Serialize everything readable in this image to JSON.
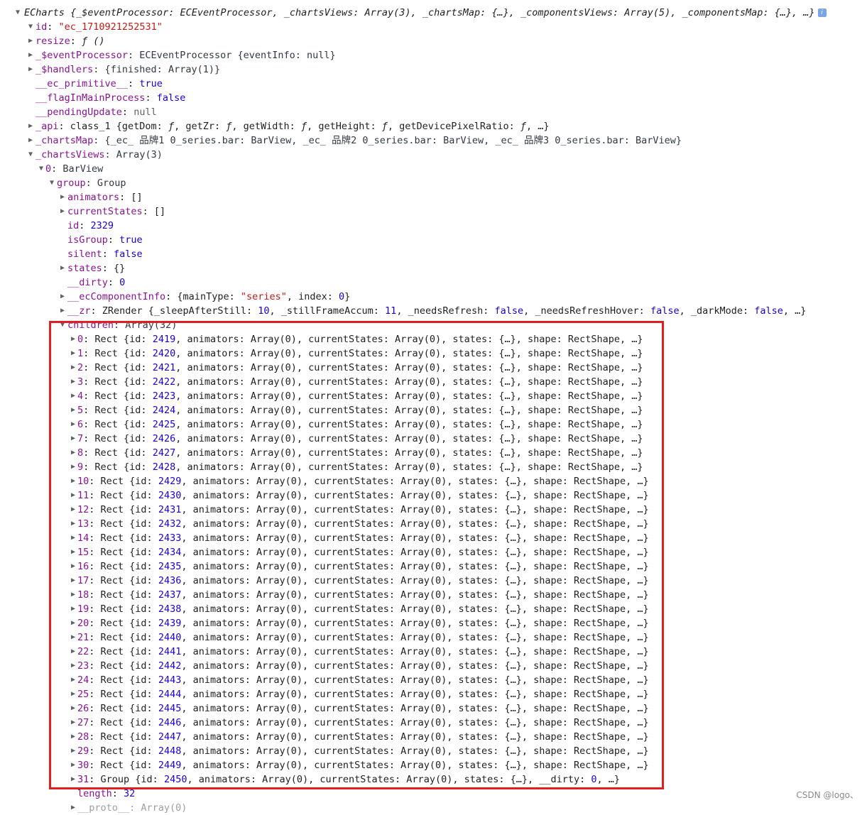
{
  "header": {
    "text": "ECharts {_$eventProcessor: ECEventProcessor, _chartsViews: Array(3), _chartsMap: {…}, _componentsViews: Array(5), _componentsMap: {…}, …}",
    "info_icon": "info-icon"
  },
  "rows": [
    {
      "indent": 0,
      "tw": "open",
      "parts": [
        {
          "t": "id",
          "c": "k-purple"
        },
        {
          "t": ": "
        },
        {
          "t": "\"ec_1710921252531\"",
          "c": "v-str"
        }
      ]
    },
    {
      "indent": 0,
      "tw": "closed",
      "parts": [
        {
          "t": "resize",
          "c": "k-purple"
        },
        {
          "t": ": "
        },
        {
          "t": "ƒ ()",
          "c": "ital"
        }
      ]
    },
    {
      "indent": 0,
      "tw": "closed",
      "parts": [
        {
          "t": "_$eventProcessor",
          "c": "k-purple"
        },
        {
          "t": ": ECEventProcessor {eventInfo: null}",
          "c": "obj"
        }
      ]
    },
    {
      "indent": 0,
      "tw": "closed",
      "parts": [
        {
          "t": "_$handlers",
          "c": "k-purple"
        },
        {
          "t": ": {finished: Array(1)}",
          "c": "obj"
        }
      ]
    },
    {
      "indent": 0,
      "tw": "none",
      "parts": [
        {
          "t": "__ec_primitive__",
          "c": "k-purple"
        },
        {
          "t": ": "
        },
        {
          "t": "true",
          "c": "v-bool"
        }
      ]
    },
    {
      "indent": 0,
      "tw": "none",
      "parts": [
        {
          "t": "__flagInMainProcess",
          "c": "k-purple"
        },
        {
          "t": ": "
        },
        {
          "t": "false",
          "c": "v-bool"
        }
      ]
    },
    {
      "indent": 0,
      "tw": "none",
      "parts": [
        {
          "t": "__pendingUpdate",
          "c": "k-purple"
        },
        {
          "t": ": "
        },
        {
          "t": "null",
          "c": "v-null"
        }
      ]
    },
    {
      "indent": 0,
      "tw": "closed",
      "parts": [
        {
          "t": "_api",
          "c": "k-purple"
        },
        {
          "t": ": class_1 {getDom: "
        },
        {
          "t": "ƒ",
          "c": "ital"
        },
        {
          "t": ", getZr: "
        },
        {
          "t": "ƒ",
          "c": "ital"
        },
        {
          "t": ", getWidth: "
        },
        {
          "t": "ƒ",
          "c": "ital"
        },
        {
          "t": ", getHeight: "
        },
        {
          "t": "ƒ",
          "c": "ital"
        },
        {
          "t": ", getDevicePixelRatio: "
        },
        {
          "t": "ƒ",
          "c": "ital"
        },
        {
          "t": ", …}"
        }
      ]
    },
    {
      "indent": 0,
      "tw": "closed",
      "parts": [
        {
          "t": "_chartsMap",
          "c": "k-purple"
        },
        {
          "t": ": {_ec_ 品牌1 0_series.bar: BarView, _ec_ 品牌2 0_series.bar: BarView, _ec_ 品牌3 0_series.bar: BarView}",
          "c": "obj"
        }
      ]
    },
    {
      "indent": 0,
      "tw": "open",
      "parts": [
        {
          "t": "_chartsViews",
          "c": "k-purple"
        },
        {
          "t": ": Array(3)",
          "c": "obj"
        }
      ]
    },
    {
      "indent": 1,
      "tw": "open",
      "parts": [
        {
          "t": "0",
          "c": "k-purple"
        },
        {
          "t": ": BarView",
          "c": "obj"
        }
      ]
    },
    {
      "indent": 2,
      "tw": "open",
      "parts": [
        {
          "t": "group",
          "c": "k-purple"
        },
        {
          "t": ": Group",
          "c": "obj"
        }
      ]
    },
    {
      "indent": 3,
      "tw": "closed",
      "parts": [
        {
          "t": "animators",
          "c": "k-purple"
        },
        {
          "t": ": []"
        }
      ]
    },
    {
      "indent": 3,
      "tw": "closed",
      "parts": [
        {
          "t": "currentStates",
          "c": "k-purple"
        },
        {
          "t": ": []"
        }
      ]
    },
    {
      "indent": 3,
      "tw": "none",
      "parts": [
        {
          "t": "id",
          "c": "k-purple"
        },
        {
          "t": ": "
        },
        {
          "t": "2329",
          "c": "v-num"
        }
      ]
    },
    {
      "indent": 3,
      "tw": "none",
      "parts": [
        {
          "t": "isGroup",
          "c": "k-purple"
        },
        {
          "t": ": "
        },
        {
          "t": "true",
          "c": "v-bool"
        }
      ]
    },
    {
      "indent": 3,
      "tw": "none",
      "parts": [
        {
          "t": "silent",
          "c": "k-purple"
        },
        {
          "t": ": "
        },
        {
          "t": "false",
          "c": "v-bool"
        }
      ]
    },
    {
      "indent": 3,
      "tw": "closed",
      "parts": [
        {
          "t": "states",
          "c": "k-purple"
        },
        {
          "t": ": {}"
        }
      ]
    },
    {
      "indent": 3,
      "tw": "none",
      "parts": [
        {
          "t": "__dirty",
          "c": "k-purple"
        },
        {
          "t": ": "
        },
        {
          "t": "0",
          "c": "v-num"
        }
      ]
    },
    {
      "indent": 3,
      "tw": "closed",
      "parts": [
        {
          "t": "__ecComponentInfo",
          "c": "k-purple"
        },
        {
          "t": ": {mainType: "
        },
        {
          "t": "\"series\"",
          "c": "v-str"
        },
        {
          "t": ", index: "
        },
        {
          "t": "0",
          "c": "v-num"
        },
        {
          "t": "}"
        }
      ]
    },
    {
      "indent": 3,
      "tw": "closed",
      "parts": [
        {
          "t": "__zr",
          "c": "k-purple"
        },
        {
          "t": ": ZRender {_sleepAfterStill: "
        },
        {
          "t": "10",
          "c": "v-num"
        },
        {
          "t": ", _stillFrameAccum: "
        },
        {
          "t": "11",
          "c": "v-num"
        },
        {
          "t": ", _needsRefresh: "
        },
        {
          "t": "false",
          "c": "v-bool"
        },
        {
          "t": ", _needsRefreshHover: "
        },
        {
          "t": "false",
          "c": "v-bool"
        },
        {
          "t": ", _darkMode: "
        },
        {
          "t": "false",
          "c": "v-bool"
        },
        {
          "t": ", …}"
        }
      ]
    },
    {
      "indent": 3,
      "tw": "open",
      "parts": [
        {
          "t": "children",
          "c": "k-purple"
        },
        {
          "t": ": Array(32)",
          "c": "obj"
        }
      ]
    },
    {
      "indent": 4,
      "tw": "closed",
      "parts": [
        {
          "t": "0",
          "c": "k-purple"
        },
        {
          "t": ": Rect {id: "
        },
        {
          "t": "2419",
          "c": "v-num"
        },
        {
          "t": ", animators: Array(0), currentStates: Array(0), states: {…}, shape: RectShape, …}"
        }
      ]
    },
    {
      "indent": 4,
      "tw": "closed",
      "parts": [
        {
          "t": "1",
          "c": "k-purple"
        },
        {
          "t": ": Rect {id: "
        },
        {
          "t": "2420",
          "c": "v-num"
        },
        {
          "t": ", animators: Array(0), currentStates: Array(0), states: {…}, shape: RectShape, …}"
        }
      ]
    },
    {
      "indent": 4,
      "tw": "closed",
      "parts": [
        {
          "t": "2",
          "c": "k-purple"
        },
        {
          "t": ": Rect {id: "
        },
        {
          "t": "2421",
          "c": "v-num"
        },
        {
          "t": ", animators: Array(0), currentStates: Array(0), states: {…}, shape: RectShape, …}"
        }
      ]
    },
    {
      "indent": 4,
      "tw": "closed",
      "parts": [
        {
          "t": "3",
          "c": "k-purple"
        },
        {
          "t": ": Rect {id: "
        },
        {
          "t": "2422",
          "c": "v-num"
        },
        {
          "t": ", animators: Array(0), currentStates: Array(0), states: {…}, shape: RectShape, …}"
        }
      ]
    },
    {
      "indent": 4,
      "tw": "closed",
      "parts": [
        {
          "t": "4",
          "c": "k-purple"
        },
        {
          "t": ": Rect {id: "
        },
        {
          "t": "2423",
          "c": "v-num"
        },
        {
          "t": ", animators: Array(0), currentStates: Array(0), states: {…}, shape: RectShape, …}"
        }
      ]
    },
    {
      "indent": 4,
      "tw": "closed",
      "parts": [
        {
          "t": "5",
          "c": "k-purple"
        },
        {
          "t": ": Rect {id: "
        },
        {
          "t": "2424",
          "c": "v-num"
        },
        {
          "t": ", animators: Array(0), currentStates: Array(0), states: {…}, shape: RectShape, …}"
        }
      ]
    },
    {
      "indent": 4,
      "tw": "closed",
      "parts": [
        {
          "t": "6",
          "c": "k-purple"
        },
        {
          "t": ": Rect {id: "
        },
        {
          "t": "2425",
          "c": "v-num"
        },
        {
          "t": ", animators: Array(0), currentStates: Array(0), states: {…}, shape: RectShape, …}"
        }
      ]
    },
    {
      "indent": 4,
      "tw": "closed",
      "parts": [
        {
          "t": "7",
          "c": "k-purple"
        },
        {
          "t": ": Rect {id: "
        },
        {
          "t": "2426",
          "c": "v-num"
        },
        {
          "t": ", animators: Array(0), currentStates: Array(0), states: {…}, shape: RectShape, …}"
        }
      ]
    },
    {
      "indent": 4,
      "tw": "closed",
      "parts": [
        {
          "t": "8",
          "c": "k-purple"
        },
        {
          "t": ": Rect {id: "
        },
        {
          "t": "2427",
          "c": "v-num"
        },
        {
          "t": ", animators: Array(0), currentStates: Array(0), states: {…}, shape: RectShape, …}"
        }
      ]
    },
    {
      "indent": 4,
      "tw": "closed",
      "parts": [
        {
          "t": "9",
          "c": "k-purple"
        },
        {
          "t": ": Rect {id: "
        },
        {
          "t": "2428",
          "c": "v-num"
        },
        {
          "t": ", animators: Array(0), currentStates: Array(0), states: {…}, shape: RectShape, …}"
        }
      ]
    },
    {
      "indent": 4,
      "tw": "closed",
      "parts": [
        {
          "t": "10",
          "c": "k-purple"
        },
        {
          "t": ": Rect {id: "
        },
        {
          "t": "2429",
          "c": "v-num"
        },
        {
          "t": ", animators: Array(0), currentStates: Array(0), states: {…}, shape: RectShape, …}"
        }
      ]
    },
    {
      "indent": 4,
      "tw": "closed",
      "parts": [
        {
          "t": "11",
          "c": "k-purple"
        },
        {
          "t": ": Rect {id: "
        },
        {
          "t": "2430",
          "c": "v-num"
        },
        {
          "t": ", animators: Array(0), currentStates: Array(0), states: {…}, shape: RectShape, …}"
        }
      ]
    },
    {
      "indent": 4,
      "tw": "closed",
      "parts": [
        {
          "t": "12",
          "c": "k-purple"
        },
        {
          "t": ": Rect {id: "
        },
        {
          "t": "2431",
          "c": "v-num"
        },
        {
          "t": ", animators: Array(0), currentStates: Array(0), states: {…}, shape: RectShape, …}"
        }
      ]
    },
    {
      "indent": 4,
      "tw": "closed",
      "parts": [
        {
          "t": "13",
          "c": "k-purple"
        },
        {
          "t": ": Rect {id: "
        },
        {
          "t": "2432",
          "c": "v-num"
        },
        {
          "t": ", animators: Array(0), currentStates: Array(0), states: {…}, shape: RectShape, …}"
        }
      ]
    },
    {
      "indent": 4,
      "tw": "closed",
      "parts": [
        {
          "t": "14",
          "c": "k-purple"
        },
        {
          "t": ": Rect {id: "
        },
        {
          "t": "2433",
          "c": "v-num"
        },
        {
          "t": ", animators: Array(0), currentStates: Array(0), states: {…}, shape: RectShape, …}"
        }
      ]
    },
    {
      "indent": 4,
      "tw": "closed",
      "parts": [
        {
          "t": "15",
          "c": "k-purple"
        },
        {
          "t": ": Rect {id: "
        },
        {
          "t": "2434",
          "c": "v-num"
        },
        {
          "t": ", animators: Array(0), currentStates: Array(0), states: {…}, shape: RectShape, …}"
        }
      ]
    },
    {
      "indent": 4,
      "tw": "closed",
      "parts": [
        {
          "t": "16",
          "c": "k-purple"
        },
        {
          "t": ": Rect {id: "
        },
        {
          "t": "2435",
          "c": "v-num"
        },
        {
          "t": ", animators: Array(0), currentStates: Array(0), states: {…}, shape: RectShape, …}"
        }
      ]
    },
    {
      "indent": 4,
      "tw": "closed",
      "parts": [
        {
          "t": "17",
          "c": "k-purple"
        },
        {
          "t": ": Rect {id: "
        },
        {
          "t": "2436",
          "c": "v-num"
        },
        {
          "t": ", animators: Array(0), currentStates: Array(0), states: {…}, shape: RectShape, …}"
        }
      ]
    },
    {
      "indent": 4,
      "tw": "closed",
      "parts": [
        {
          "t": "18",
          "c": "k-purple"
        },
        {
          "t": ": Rect {id: "
        },
        {
          "t": "2437",
          "c": "v-num"
        },
        {
          "t": ", animators: Array(0), currentStates: Array(0), states: {…}, shape: RectShape, …}"
        }
      ]
    },
    {
      "indent": 4,
      "tw": "closed",
      "parts": [
        {
          "t": "19",
          "c": "k-purple"
        },
        {
          "t": ": Rect {id: "
        },
        {
          "t": "2438",
          "c": "v-num"
        },
        {
          "t": ", animators: Array(0), currentStates: Array(0), states: {…}, shape: RectShape, …}"
        }
      ]
    },
    {
      "indent": 4,
      "tw": "closed",
      "parts": [
        {
          "t": "20",
          "c": "k-purple"
        },
        {
          "t": ": Rect {id: "
        },
        {
          "t": "2439",
          "c": "v-num"
        },
        {
          "t": ", animators: Array(0), currentStates: Array(0), states: {…}, shape: RectShape, …}"
        }
      ]
    },
    {
      "indent": 4,
      "tw": "closed",
      "parts": [
        {
          "t": "21",
          "c": "k-purple"
        },
        {
          "t": ": Rect {id: "
        },
        {
          "t": "2440",
          "c": "v-num"
        },
        {
          "t": ", animators: Array(0), currentStates: Array(0), states: {…}, shape: RectShape, …}"
        }
      ]
    },
    {
      "indent": 4,
      "tw": "closed",
      "parts": [
        {
          "t": "22",
          "c": "k-purple"
        },
        {
          "t": ": Rect {id: "
        },
        {
          "t": "2441",
          "c": "v-num"
        },
        {
          "t": ", animators: Array(0), currentStates: Array(0), states: {…}, shape: RectShape, …}"
        }
      ]
    },
    {
      "indent": 4,
      "tw": "closed",
      "parts": [
        {
          "t": "23",
          "c": "k-purple"
        },
        {
          "t": ": Rect {id: "
        },
        {
          "t": "2442",
          "c": "v-num"
        },
        {
          "t": ", animators: Array(0), currentStates: Array(0), states: {…}, shape: RectShape, …}"
        }
      ]
    },
    {
      "indent": 4,
      "tw": "closed",
      "parts": [
        {
          "t": "24",
          "c": "k-purple"
        },
        {
          "t": ": Rect {id: "
        },
        {
          "t": "2443",
          "c": "v-num"
        },
        {
          "t": ", animators: Array(0), currentStates: Array(0), states: {…}, shape: RectShape, …}"
        }
      ]
    },
    {
      "indent": 4,
      "tw": "closed",
      "parts": [
        {
          "t": "25",
          "c": "k-purple"
        },
        {
          "t": ": Rect {id: "
        },
        {
          "t": "2444",
          "c": "v-num"
        },
        {
          "t": ", animators: Array(0), currentStates: Array(0), states: {…}, shape: RectShape, …}"
        }
      ]
    },
    {
      "indent": 4,
      "tw": "closed",
      "parts": [
        {
          "t": "26",
          "c": "k-purple"
        },
        {
          "t": ": Rect {id: "
        },
        {
          "t": "2445",
          "c": "v-num"
        },
        {
          "t": ", animators: Array(0), currentStates: Array(0), states: {…}, shape: RectShape, …}"
        }
      ]
    },
    {
      "indent": 4,
      "tw": "closed",
      "parts": [
        {
          "t": "27",
          "c": "k-purple"
        },
        {
          "t": ": Rect {id: "
        },
        {
          "t": "2446",
          "c": "v-num"
        },
        {
          "t": ", animators: Array(0), currentStates: Array(0), states: {…}, shape: RectShape, …}"
        }
      ]
    },
    {
      "indent": 4,
      "tw": "closed",
      "parts": [
        {
          "t": "28",
          "c": "k-purple"
        },
        {
          "t": ": Rect {id: "
        },
        {
          "t": "2447",
          "c": "v-num"
        },
        {
          "t": ", animators: Array(0), currentStates: Array(0), states: {…}, shape: RectShape, …}"
        }
      ]
    },
    {
      "indent": 4,
      "tw": "closed",
      "parts": [
        {
          "t": "29",
          "c": "k-purple"
        },
        {
          "t": ": Rect {id: "
        },
        {
          "t": "2448",
          "c": "v-num"
        },
        {
          "t": ", animators: Array(0), currentStates: Array(0), states: {…}, shape: RectShape, …}"
        }
      ]
    },
    {
      "indent": 4,
      "tw": "closed",
      "parts": [
        {
          "t": "30",
          "c": "k-purple"
        },
        {
          "t": ": Rect {id: "
        },
        {
          "t": "2449",
          "c": "v-num"
        },
        {
          "t": ", animators: Array(0), currentStates: Array(0), states: {…}, shape: RectShape, …}"
        }
      ]
    },
    {
      "indent": 4,
      "tw": "closed",
      "parts": [
        {
          "t": "31",
          "c": "k-purple"
        },
        {
          "t": ": Group {id: "
        },
        {
          "t": "2450",
          "c": "v-num"
        },
        {
          "t": ", animators: Array(0), currentStates: Array(0), states: {…}, __dirty: "
        },
        {
          "t": "0",
          "c": "v-num"
        },
        {
          "t": ", …}"
        }
      ]
    },
    {
      "indent": 4,
      "tw": "none",
      "parts": [
        {
          "t": "length",
          "c": "k-purple"
        },
        {
          "t": ": "
        },
        {
          "t": "32",
          "c": "v-num"
        }
      ]
    },
    {
      "indent": 4,
      "tw": "closed",
      "parts": [
        {
          "t": "__proto__",
          "c": "k-purple faded"
        },
        {
          "t": ": Array(0)",
          "c": "faded"
        }
      ]
    }
  ],
  "watermark": "CSDN @logo、",
  "colors": {
    "key": "#881391",
    "string": "#c41a16",
    "number": "#1c00cf",
    "highlight": "#e02020"
  }
}
